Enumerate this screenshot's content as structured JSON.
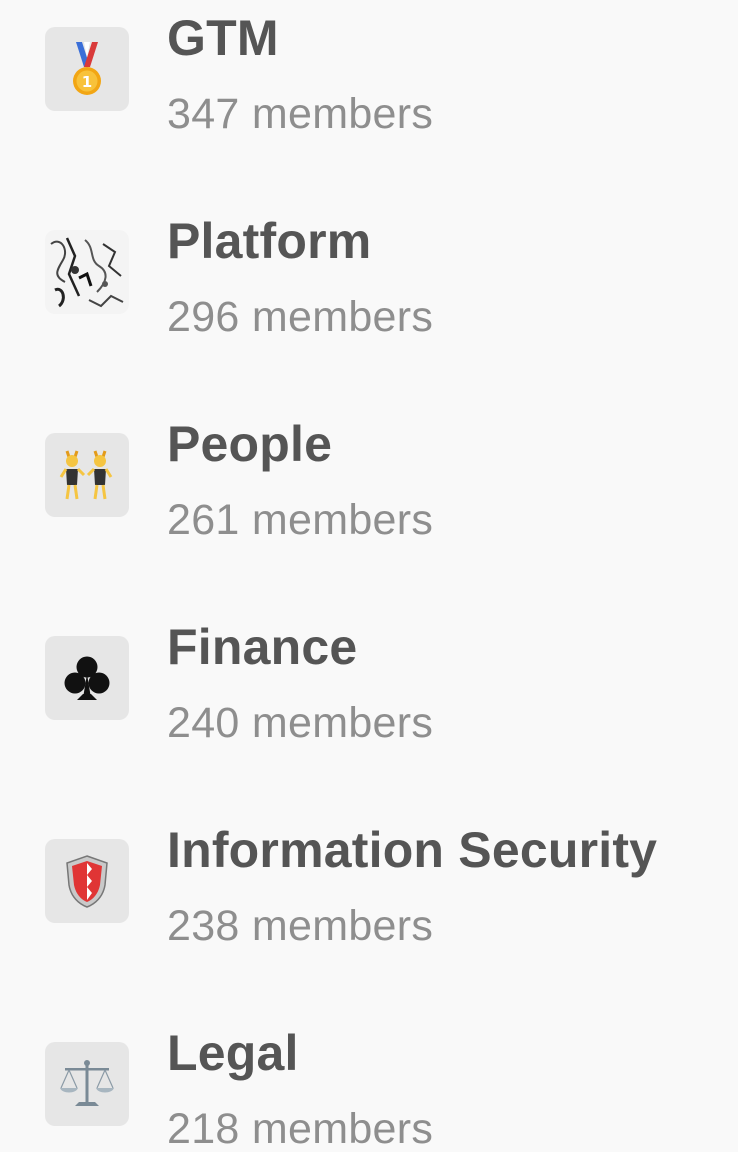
{
  "channels": [
    {
      "name": "GTM",
      "members": "347 members",
      "icon": "medal-icon"
    },
    {
      "name": "Platform",
      "members": "296 members",
      "icon": "sketch-art-icon"
    },
    {
      "name": "People",
      "members": "261 members",
      "icon": "dancers-icon"
    },
    {
      "name": "Finance",
      "members": "240 members",
      "icon": "club-suit-icon"
    },
    {
      "name": "Information Security",
      "members": "238 members",
      "icon": "shield-icon"
    },
    {
      "name": "Legal",
      "members": "218 members",
      "icon": "scales-icon"
    }
  ]
}
